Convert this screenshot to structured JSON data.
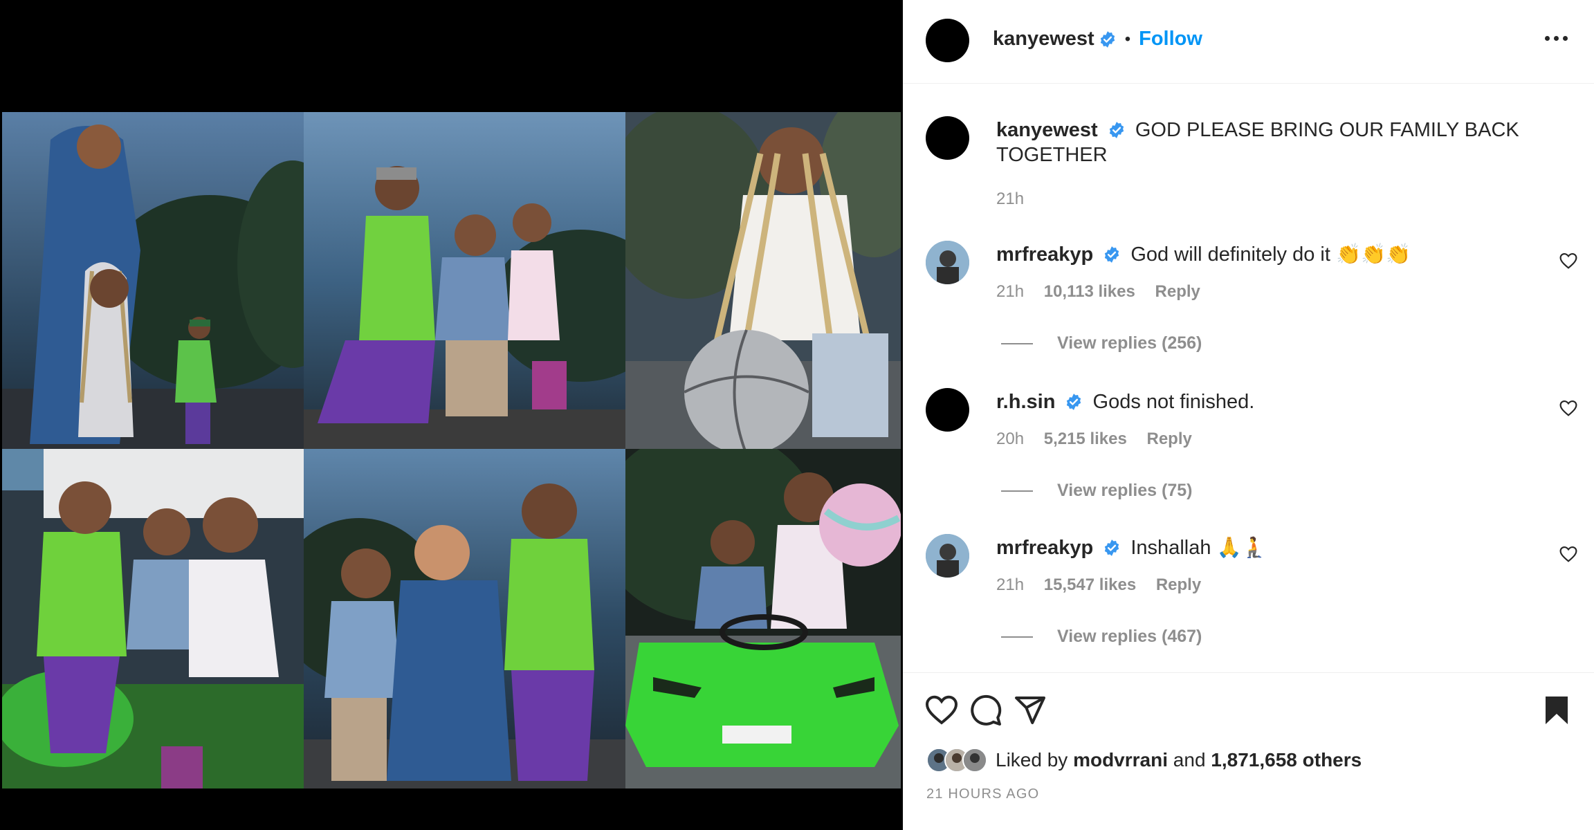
{
  "post": {
    "author": "kanyewest",
    "follow_label": "Follow",
    "separator": "•"
  },
  "caption": {
    "username": "kanyewest",
    "text": "GOD PLEASE BRING OUR FAMILY BACK TOGETHER",
    "time": "21h"
  },
  "comments": [
    {
      "username": "mrfreakyp",
      "text": "God will definitely do it 👏👏👏",
      "time": "21h",
      "likes": "10,113 likes",
      "reply_label": "Reply",
      "view_replies": "View replies (256)"
    },
    {
      "username": "r.h.sin",
      "text": "Gods not finished.",
      "time": "20h",
      "likes": "5,215 likes",
      "reply_label": "Reply",
      "view_replies": "View replies (75)"
    },
    {
      "username": "mrfreakyp",
      "text": "Inshallah 🙏🧎",
      "time": "21h",
      "likes": "15,547 likes",
      "reply_label": "Reply",
      "view_replies": "View replies (467)"
    }
  ],
  "likes_summary": {
    "prefix": "Liked by",
    "first_liker": "modvrrani",
    "conjunction": "and",
    "others": "1,871,658 others"
  },
  "timestamp": "21 HOURS AGO",
  "icons": {
    "verified": "verified-badge-icon",
    "more": "more-options-icon",
    "like": "heart-icon",
    "comment": "comment-icon",
    "share": "paper-plane-icon",
    "save": "bookmark-icon"
  },
  "colors": {
    "link_blue": "#0095f6",
    "verified_blue": "#3897f0",
    "muted_text": "#8e8e8e",
    "primary_text": "#262626"
  }
}
